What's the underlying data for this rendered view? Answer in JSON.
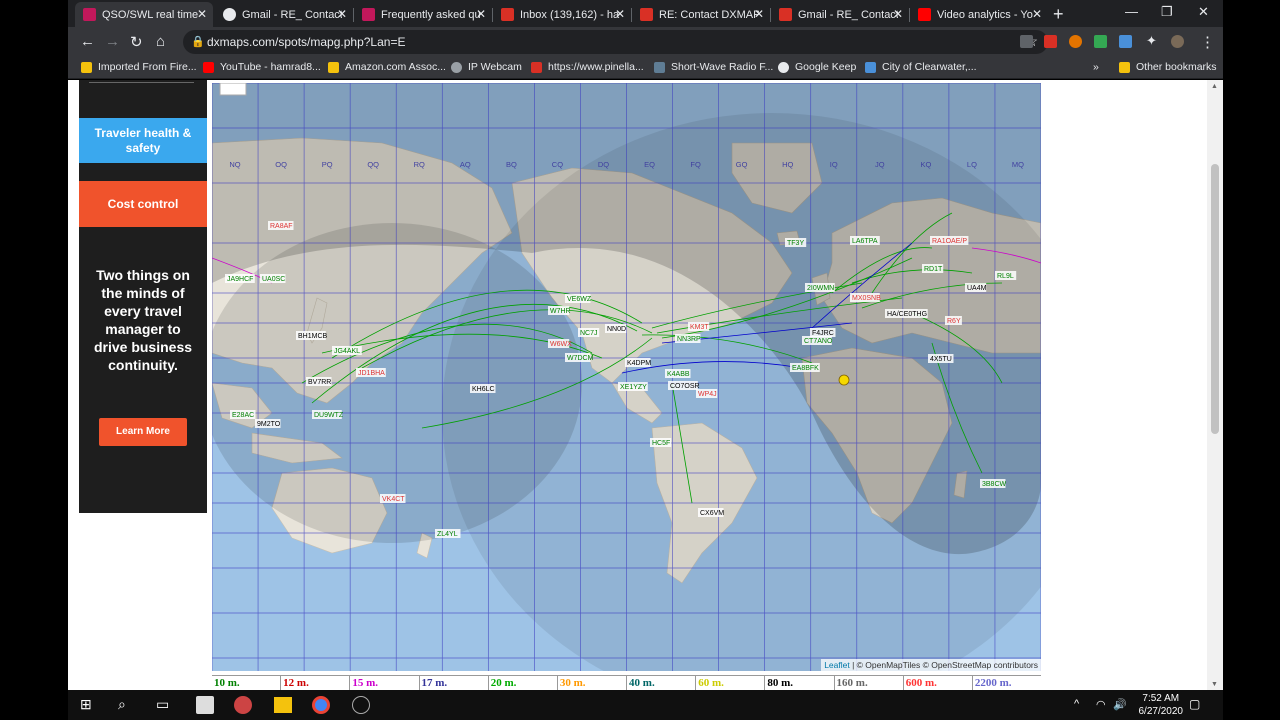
{
  "tabs": [
    {
      "title": "QSO/SWL real time",
      "favicon_color": "#c2185b",
      "active": true
    },
    {
      "title": "Gmail - RE_ Contact",
      "favicon_color": "#e8eaed",
      "active": false
    },
    {
      "title": "Frequently asked qu",
      "favicon_color": "#c2185b",
      "active": false
    },
    {
      "title": "Inbox (139,162) - ha",
      "favicon_color": "#d93025",
      "active": false
    },
    {
      "title": "RE: Contact DXMAP",
      "favicon_color": "#d93025",
      "active": false
    },
    {
      "title": "Gmail - RE_ Contact",
      "favicon_color": "#d93025",
      "active": false
    },
    {
      "title": "Video analytics - Yo",
      "favicon_color": "#ff0000",
      "active": false
    }
  ],
  "toolbar": {
    "url": "dxmaps.com/spots/mapg.php?Lan=E"
  },
  "bookmarks": [
    {
      "label": "Imported From Fire...",
      "color": "#f4c20d"
    },
    {
      "label": "YouTube - hamrad8...",
      "color": "#ff0000"
    },
    {
      "label": "Amazon.com Assoc...",
      "color": "#f4c20d"
    },
    {
      "label": "IP Webcam",
      "color": "#9aa0a6"
    },
    {
      "label": "https://www.pinella...",
      "color": "#d93025"
    },
    {
      "label": "Short-Wave Radio F...",
      "color": "#5f7d95"
    },
    {
      "label": "Google Keep",
      "color": "#e8eaed"
    },
    {
      "label": "City of Clearwater,...",
      "color": "#4a90d9"
    }
  ],
  "other_bookmarks": "Other bookmarks",
  "ad": {
    "blue_label": "Traveler health & safety",
    "orange_label": "Cost control",
    "headline": "Two things on the minds of every travel manager to drive business continuity.",
    "button": "Learn More"
  },
  "map": {
    "attribution_leaflet": "Leaflet",
    "attribution_rest": " | © OpenMapTiles © OpenStreetMap contributors",
    "grid_cols": [
      "NQ",
      "OQ",
      "PQ",
      "QQ",
      "RQ",
      "AQ",
      "BQ",
      "CQ",
      "DQ",
      "EQ",
      "FQ",
      "GQ",
      "HQ",
      "IQ",
      "JQ",
      "KQ",
      "LQ",
      "MQ"
    ],
    "callsigns": [
      "RA8AF",
      "UA0SC",
      "JA9HCF",
      "BH1MCB",
      "JG4AKL",
      "JD1BHA",
      "BV7RR",
      "DU9WTZ",
      "E28AC",
      "9M2TO",
      "VK4CT",
      "ZL4YL",
      "KH6LC",
      "W7HR",
      "VE6WZ",
      "W6WX",
      "NC7J",
      "W7DCM",
      "NN0D",
      "NN3RP",
      "KM3T",
      "K4DPM",
      "XE1YZY",
      "K4ABB",
      "CO7OSR",
      "WP4J",
      "HC5F",
      "CX6VM",
      "TF3Y",
      "LA6TPA",
      "RA1OAE/P",
      "RD1T",
      "RL9L",
      "UA4M",
      "2I0WMN",
      "MX0SNB",
      "HA/CE0THG",
      "CT7ANO",
      "EA8BFK",
      "4X5TU",
      "R6Y",
      "3B8CW",
      "F4JRC"
    ],
    "sun_marker_color": "#f5d800"
  },
  "bands": [
    {
      "label": "10 m.",
      "color": "#008000"
    },
    {
      "label": "12 m.",
      "color": "#cc0000"
    },
    {
      "label": "15 m.",
      "color": "#cc00cc"
    },
    {
      "label": "17 m.",
      "color": "#333399"
    },
    {
      "label": "20 m.",
      "color": "#00aa00"
    },
    {
      "label": "30 m.",
      "color": "#ff9900"
    },
    {
      "label": "40 m.",
      "color": "#006666"
    },
    {
      "label": "60 m.",
      "color": "#cccc00"
    },
    {
      "label": "80 m.",
      "color": "#000000"
    },
    {
      "label": "160 m.",
      "color": "#666666"
    },
    {
      "label": "600 m.",
      "color": "#ff3333"
    },
    {
      "label": "2200 m.",
      "color": "#6666cc"
    }
  ],
  "taskbar": {
    "time": "7:52 AM",
    "date": "6/27/2020"
  }
}
